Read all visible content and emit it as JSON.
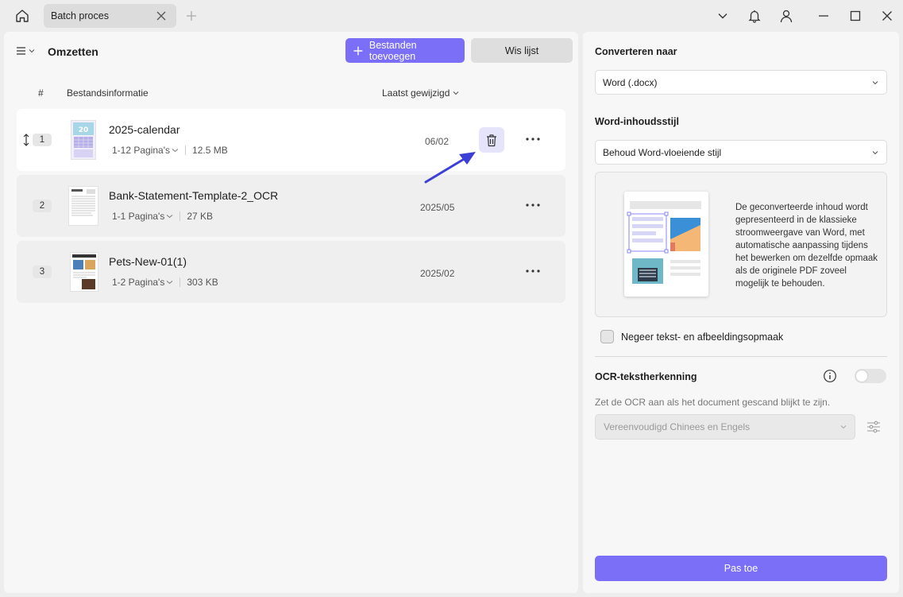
{
  "titlebar": {
    "tab_label": "Batch proces",
    "icons": [
      "home-icon",
      "close-icon",
      "plus-icon",
      "chevron-down-icon",
      "bell-icon",
      "user-icon",
      "minimize-icon",
      "maximize-icon",
      "close-window-icon"
    ]
  },
  "left": {
    "title": "Omzetten",
    "add_button": "Bestanden toevoegen",
    "clear_button": "Wis lijst",
    "columns": {
      "hash": "#",
      "info": "Bestandsinformatie",
      "modified": "Laatst gewijzigd"
    },
    "files": [
      {
        "num": "1",
        "name": "2025-calendar",
        "pages": "1-12 Pagina's",
        "size": "12.5 MB",
        "date": "06/02"
      },
      {
        "num": "2",
        "name": "Bank-Statement-Template-2_OCR",
        "pages": "1-1 Pagina's",
        "size": "27 KB",
        "date": "2025/05"
      },
      {
        "num": "3",
        "name": "Pets-New-01(1)",
        "pages": "1-2 Pagina's",
        "size": "303 KB",
        "date": "2025/02"
      }
    ]
  },
  "right": {
    "convert_label": "Converteren naar",
    "convert_value": "Word (.docx)",
    "style_label": "Word-inhoudsstijl",
    "style_value": "Behoud Word-vloeiende stijl",
    "style_description": "De geconverteerde inhoud wordt gepresenteerd in de klassieke stroomweergave van Word, met automatische aanpassing tijdens het bewerken om dezelfde opmaak als de originele PDF zoveel mogelijk te behouden.",
    "ignore_format_label": "Negeer tekst- en afbeeldingsopmaak",
    "ocr_label": "OCR-tekstherkenning",
    "ocr_hint": "Zet de OCR aan als het document gescand blijkt te zijn.",
    "ocr_language": "Vereenvoudigd Chinees en Engels",
    "ocr_enabled": false,
    "apply_button": "Pas toe"
  },
  "colors": {
    "accent": "#7b6ff7",
    "arrow": "#3b3fd6"
  }
}
